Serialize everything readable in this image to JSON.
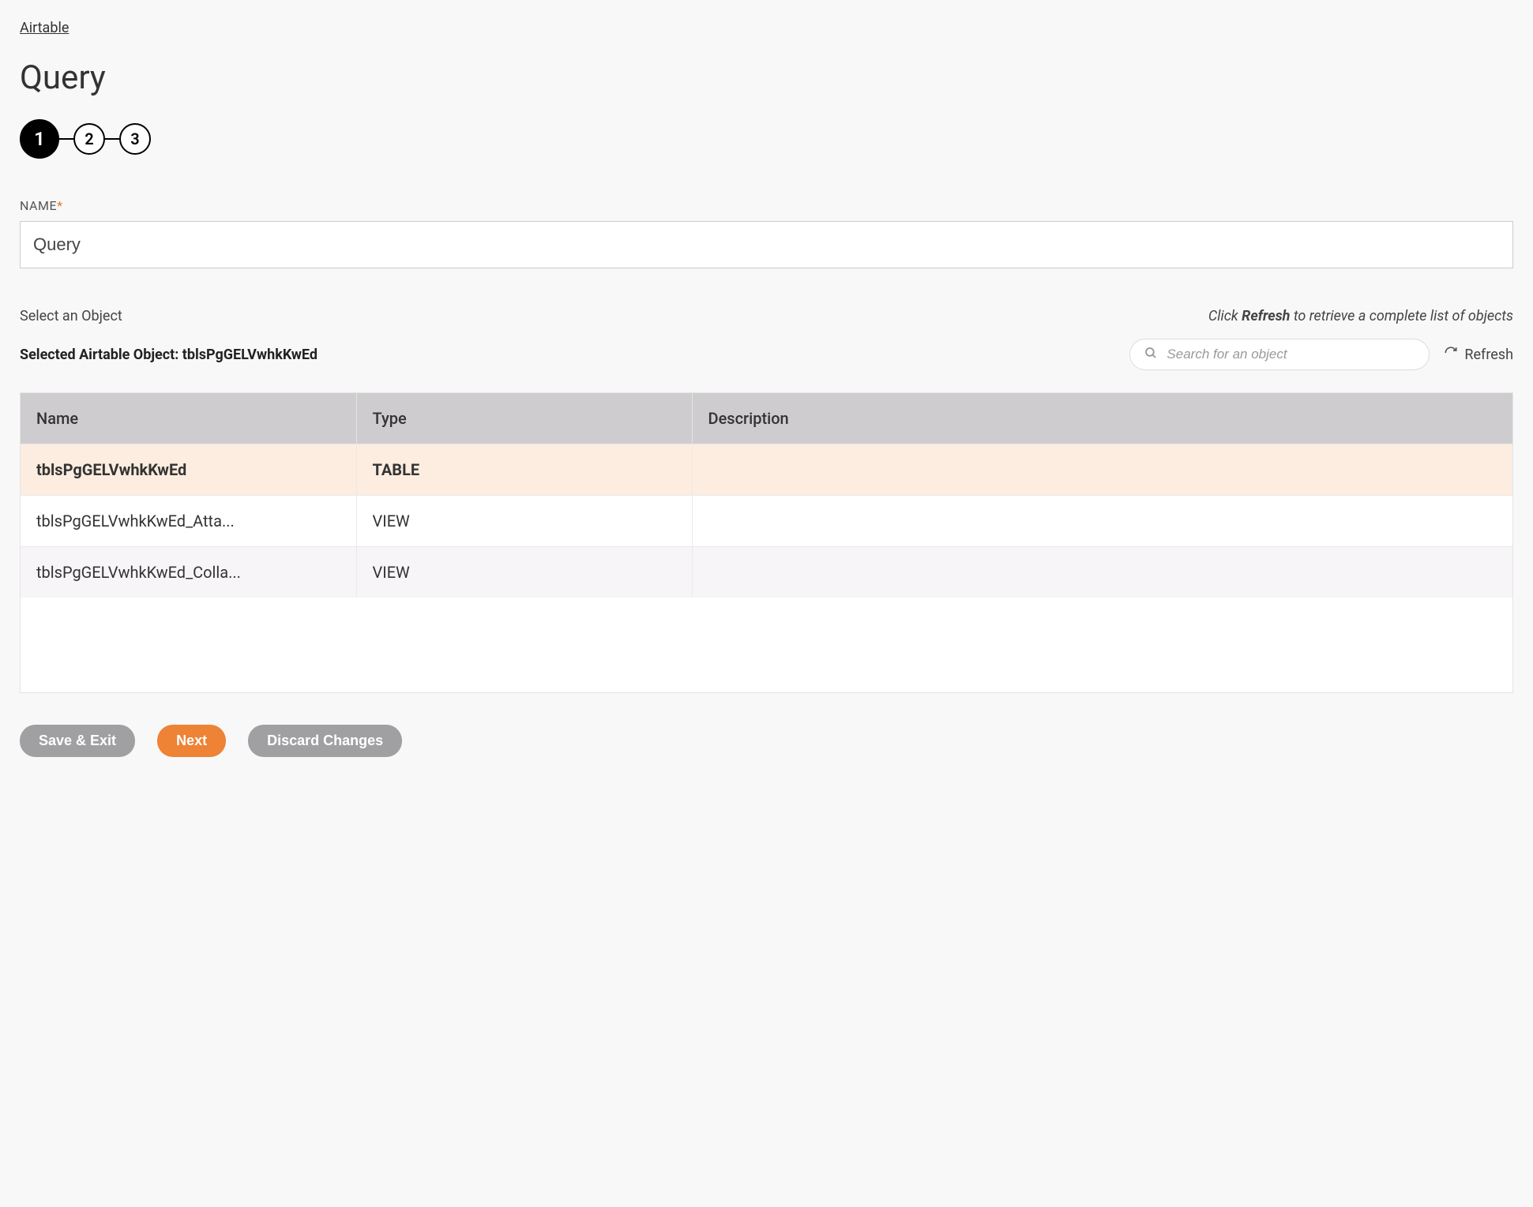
{
  "breadcrumb": "Airtable",
  "page_title": "Query",
  "stepper": {
    "step1": "1",
    "step2": "2",
    "step3": "3"
  },
  "name_field": {
    "label": "NAME",
    "required": "*",
    "value": "Query"
  },
  "object_section": {
    "select_label": "Select an Object",
    "hint_prefix": "Click ",
    "hint_bold": "Refresh",
    "hint_suffix": " to retrieve a complete list of objects",
    "selected_prefix": "Selected Airtable Object: ",
    "selected_value": "tblsPgGELVwhkKwEd",
    "search_placeholder": "Search for an object",
    "refresh_label": "Refresh"
  },
  "table": {
    "headers": {
      "name": "Name",
      "type": "Type",
      "description": "Description"
    },
    "rows": [
      {
        "name": "tblsPgGELVwhkKwEd",
        "type": "TABLE",
        "description": ""
      },
      {
        "name": "tblsPgGELVwhkKwEd_Atta...",
        "type": "VIEW",
        "description": ""
      },
      {
        "name": "tblsPgGELVwhkKwEd_Colla...",
        "type": "VIEW",
        "description": ""
      }
    ]
  },
  "buttons": {
    "save_exit": "Save & Exit",
    "next": "Next",
    "discard": "Discard Changes"
  }
}
